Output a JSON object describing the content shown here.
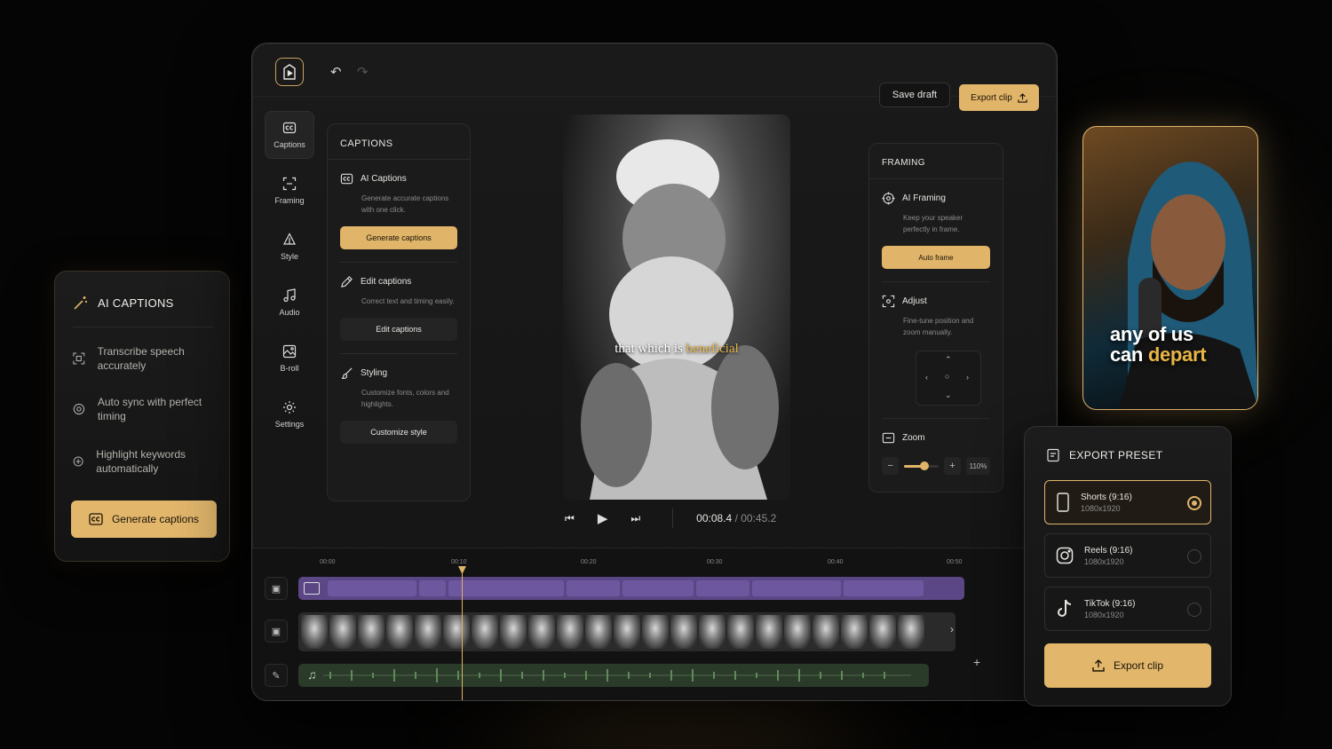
{
  "app": {
    "save_draft": "Save draft",
    "export_clip": "Export clip",
    "accent": "#e0b469",
    "icons": {
      "logo": "play-logo-icon",
      "undo": "undo-icon",
      "redo": "redo-icon",
      "upload": "upload-icon"
    }
  },
  "nav": {
    "items": [
      {
        "label": "Captions",
        "icon": "cc-icon"
      },
      {
        "label": "Framing",
        "icon": "frame-icon"
      },
      {
        "label": "Style",
        "icon": "style-icon"
      },
      {
        "label": "Audio",
        "icon": "music-icon"
      },
      {
        "label": "B-roll",
        "icon": "image-icon"
      },
      {
        "label": "Settings",
        "icon": "gear-icon"
      }
    ],
    "active": "Captions"
  },
  "captions_panel": {
    "title": "CAPTIONS",
    "sections": [
      {
        "title": "AI Captions",
        "desc": "Generate accurate captions with one click.",
        "button": "Generate captions"
      },
      {
        "title": "Edit captions",
        "desc": "Correct text and timing easily.",
        "button": "Edit captions"
      },
      {
        "title": "Styling",
        "desc": "Customize fonts, colors and highlights.",
        "button": "Customize style"
      }
    ]
  },
  "video": {
    "caption_text": "that which is",
    "caption_highlight": "beneficial",
    "current_time": "00:08.4",
    "separator": "/",
    "total_time": "00:45.2"
  },
  "framing_panel": {
    "title": "FRAMING",
    "ai_framing": {
      "title": "AI Framing",
      "desc": "Keep your speaker perfectly in frame.",
      "button": "Auto frame"
    },
    "adjust": {
      "title": "Adjust",
      "desc": "Fine-tune position and zoom manually."
    },
    "zoom": {
      "title": "Zoom",
      "value": "110%",
      "level": 0.6
    }
  },
  "timeline": {
    "ticks": [
      "00:00",
      "00:10",
      "00:20",
      "00:30",
      "00:40",
      "00:50"
    ],
    "add_label": "+"
  },
  "ai_card": {
    "title": "AI CAPTIONS",
    "features": [
      {
        "text": "Transcribe speech accurately",
        "icon": "scan-icon"
      },
      {
        "text": "Auto sync with perfect timing",
        "icon": "sync-icon"
      },
      {
        "text": "Highlight keywords automatically",
        "icon": "highlight-icon"
      }
    ],
    "button": "Generate captions"
  },
  "preview": {
    "line1": "any of us",
    "line2_plain": "can",
    "line2_highlight": "depart"
  },
  "export_preset": {
    "title": "EXPORT PRESET",
    "presets": [
      {
        "name": "Shorts (9:16)",
        "res": "1080x1920",
        "icon": "phone-icon",
        "selected": true
      },
      {
        "name": "Reels (9:16)",
        "res": "1080x1920",
        "icon": "instagram-icon",
        "selected": false
      },
      {
        "name": "TikTok (9:16)",
        "res": "1080x1920",
        "icon": "tiktok-icon",
        "selected": false
      }
    ],
    "button": "Export clip"
  }
}
